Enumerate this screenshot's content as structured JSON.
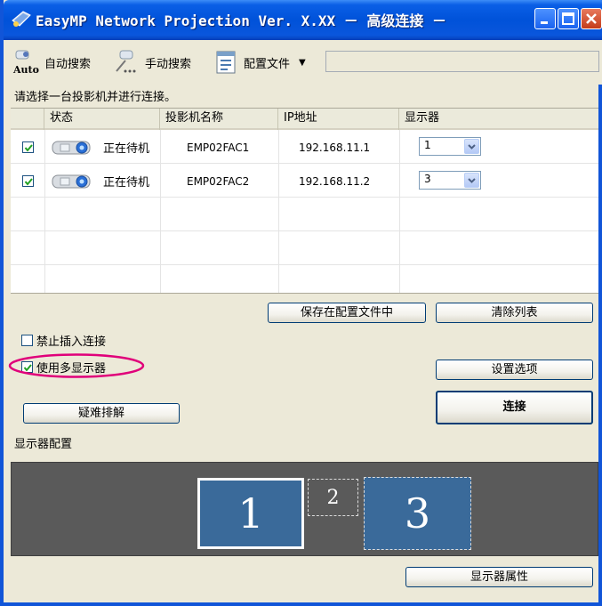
{
  "window": {
    "title": "EasyMP Network Projection Ver. X.XX － 高级连接 －",
    "accent": "#0052d9"
  },
  "toolbar": {
    "auto_search_icon_label": "Auto",
    "auto_search": "自动搜索",
    "manual_search": "手动搜索",
    "profile": "配置文件",
    "profile_field_value": ""
  },
  "prompt": "请选择一台投影机并进行连接。",
  "table": {
    "columns": [
      "状态",
      "投影机名称",
      "IP地址",
      "显示器"
    ],
    "rows": [
      {
        "checked": true,
        "status": "正在待机",
        "name": "EMP02FAC1",
        "ip": "192.168.11.1",
        "display": "1"
      },
      {
        "checked": true,
        "status": "正在待机",
        "name": "EMP02FAC2",
        "ip": "192.168.11.2",
        "display": "3"
      }
    ]
  },
  "buttons": {
    "save_profile": "保存在配置文件中",
    "clear_list": "清除列表",
    "set_options": "设置选项",
    "troubleshoot": "疑难排解",
    "connect": "连接",
    "display_properties": "显示器属性"
  },
  "options": {
    "disable_interrupt": {
      "label": "禁止插入连接",
      "checked": false
    },
    "multi_display": {
      "label": "使用多显示器",
      "checked": true
    }
  },
  "display_config": {
    "label": "显示器配置",
    "monitors": [
      {
        "number": "1",
        "selected": true
      },
      {
        "number": "2",
        "selected": false
      },
      {
        "number": "3",
        "selected": false
      }
    ]
  },
  "colors": {
    "highlight_ellipse": "#e0007a",
    "display_bg": "#5a5a5a",
    "monitor_fill": "#3a6a9a"
  }
}
